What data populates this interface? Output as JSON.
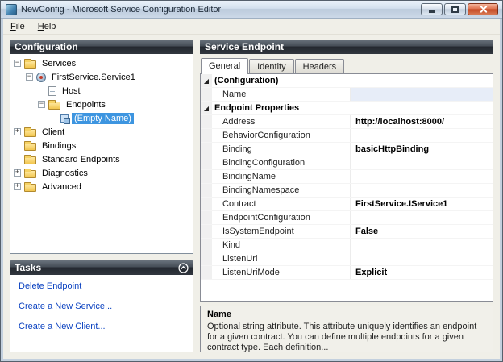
{
  "window": {
    "title": "NewConfig - Microsoft Service Configuration Editor"
  },
  "menu": {
    "items": [
      {
        "label": "File"
      },
      {
        "label": "Help"
      }
    ]
  },
  "left": {
    "header": "Configuration",
    "tree": [
      {
        "label": "Services",
        "level": 0,
        "expander": "-",
        "icon": "folder",
        "selected": false
      },
      {
        "label": "FirstService.Service1",
        "level": 1,
        "expander": "-",
        "icon": "service",
        "selected": false
      },
      {
        "label": "Host",
        "level": 2,
        "expander": "",
        "icon": "host",
        "selected": false
      },
      {
        "label": "Endpoints",
        "level": 2,
        "expander": "-",
        "icon": "folder",
        "selected": false
      },
      {
        "label": "(Empty Name)",
        "level": 3,
        "expander": "",
        "icon": "endpoint",
        "selected": true
      },
      {
        "label": "Client",
        "level": 0,
        "expander": "+",
        "icon": "folder",
        "selected": false
      },
      {
        "label": "Bindings",
        "level": 0,
        "expander": "",
        "icon": "folder",
        "selected": false
      },
      {
        "label": "Standard Endpoints",
        "level": 0,
        "expander": "",
        "icon": "folder",
        "selected": false
      },
      {
        "label": "Diagnostics",
        "level": 0,
        "expander": "+",
        "icon": "folder",
        "selected": false
      },
      {
        "label": "Advanced",
        "level": 0,
        "expander": "+",
        "icon": "folder",
        "selected": false
      }
    ],
    "tasks": {
      "header": "Tasks",
      "items": [
        {
          "label": "Delete Endpoint"
        },
        {
          "label": "Create a New Service..."
        },
        {
          "label": "Create a New Client..."
        }
      ]
    }
  },
  "right": {
    "header": "Service Endpoint",
    "tabs": [
      {
        "label": "General",
        "active": true
      },
      {
        "label": "Identity",
        "active": false
      },
      {
        "label": "Headers",
        "active": false
      }
    ],
    "grid": [
      {
        "type": "category",
        "label": "(Configuration)"
      },
      {
        "type": "row",
        "label": "Name",
        "value": "",
        "bold": false,
        "highlight": true
      },
      {
        "type": "category",
        "label": "Endpoint Properties"
      },
      {
        "type": "row",
        "label": "Address",
        "value": "http://localhost:8000/",
        "bold": true,
        "highlight": false
      },
      {
        "type": "row",
        "label": "BehaviorConfiguration",
        "value": "",
        "bold": false,
        "highlight": false
      },
      {
        "type": "row",
        "label": "Binding",
        "value": "basicHttpBinding",
        "bold": true,
        "highlight": false
      },
      {
        "type": "row",
        "label": "BindingConfiguration",
        "value": "",
        "bold": false,
        "highlight": false
      },
      {
        "type": "row",
        "label": "BindingName",
        "value": "",
        "bold": false,
        "highlight": false
      },
      {
        "type": "row",
        "label": "BindingNamespace",
        "value": "",
        "bold": false,
        "highlight": false
      },
      {
        "type": "row",
        "label": "Contract",
        "value": "FirstService.IService1",
        "bold": true,
        "highlight": false
      },
      {
        "type": "row",
        "label": "EndpointConfiguration",
        "value": "",
        "bold": false,
        "highlight": false
      },
      {
        "type": "row",
        "label": "IsSystemEndpoint",
        "value": "False",
        "bold": true,
        "highlight": false
      },
      {
        "type": "row",
        "label": "Kind",
        "value": "",
        "bold": false,
        "highlight": false
      },
      {
        "type": "row",
        "label": "ListenUri",
        "value": "",
        "bold": false,
        "highlight": false
      },
      {
        "type": "row",
        "label": "ListenUriMode",
        "value": "Explicit",
        "bold": true,
        "highlight": false
      }
    ],
    "help": {
      "title": "Name",
      "text": "Optional string attribute. This attribute uniquely identifies an endpoint for a given contract. You can define multiple endpoints for a given contract type. Each definition..."
    }
  }
}
